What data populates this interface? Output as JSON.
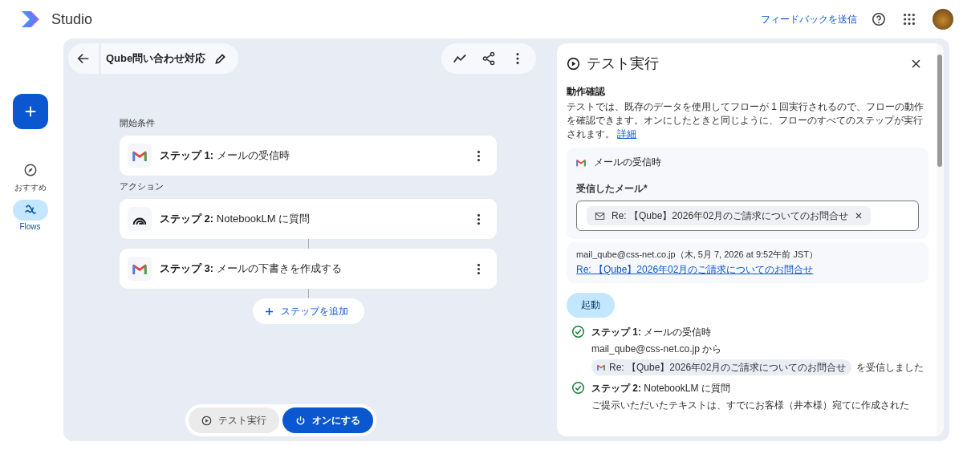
{
  "app": {
    "name": "Studio"
  },
  "header": {
    "feedback_link": "フィードバックを送信"
  },
  "rail": {
    "items": [
      {
        "label": "おすすめ",
        "selected": false
      },
      {
        "label": "Flows",
        "selected": true
      }
    ]
  },
  "flow": {
    "title": "Qube問い合わせ対応",
    "sections": [
      {
        "heading": "開始条件",
        "steps": [
          {
            "text": "**ステップ 1:** メールの受信時",
            "kind": "mail"
          }
        ]
      },
      {
        "heading": "アクション",
        "steps": [
          {
            "text": "**ステップ 2:** NotebookLM に質問",
            "kind": "notebook"
          },
          {
            "text": "**ステップ 3:** メールの下書きを作成する",
            "kind": "mail"
          }
        ]
      }
    ],
    "add_step": "ステップを追加",
    "test_button": "テスト実行",
    "on_button": "オンにする"
  },
  "panel": {
    "title": "テスト実行",
    "heading": "動作確認",
    "description": "テストでは、既存のデータを使用してフローが 1 回実行されるので、フローの動作を確認できます。オンにしたときと同じように、フローのすべてのステップが実行されます。",
    "link": "詳細",
    "trigger": {
      "title": "メールの受信時",
      "field_label": "受信したメール*",
      "chip": "Re: 【Qube】2026年02月のご請求についてのお問合せ"
    },
    "mail_info": "mail_qube@css-net.co.jp（木, 5月 7, 2026 at 9:52午前 JST）",
    "mail_link": "Re: 【Qube】2026年02月のご請求についてのお問合せ",
    "start_button": "起動",
    "results": [
      {
        "title": "**ステップ 1:** メールの受信時",
        "lines": [
          {
            "kind": "text",
            "text": "mail_qube@css-net.co.jp から"
          },
          {
            "kind": "chip",
            "chip": "Re: 【Qube】2026年02月のご請求についてのお問合せ",
            "text": "を受信しました"
          }
        ]
      },
      {
        "title": "**ステップ 2:** NotebookLM に質問",
        "lines": [
          {
            "kind": "text",
            "text": "ご提示いただいたテキストは、すでにお客様（井本様）宛てに作成された"
          }
        ]
      }
    ]
  }
}
